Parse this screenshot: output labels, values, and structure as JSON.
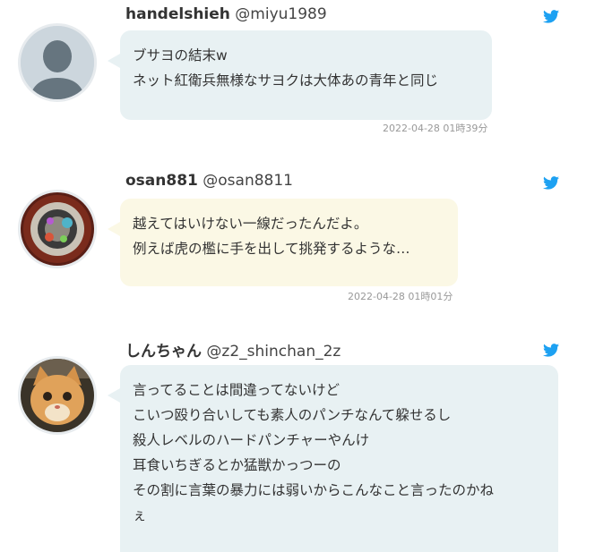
{
  "comments": [
    {
      "name": "handelshieh",
      "handle": "@miyu1989",
      "lines": [
        "ブサヨの結末w",
        "ネット紅衛兵無様なサヨクは大体あの青年と同じ"
      ],
      "timestamp": "2022-04-28 01時39分",
      "avatar_icon": "default-user-icon",
      "bubble_color": "#e8f1f3"
    },
    {
      "name": "osan881",
      "handle": "@osan8811",
      "lines": [
        "越えてはいけない一線だったんだよ。",
        "例えば虎の檻に手を出して挑発するような…"
      ],
      "timestamp": "2022-04-28 01時01分",
      "avatar_icon": "medallion-avatar-icon",
      "bubble_color": "#fbf8e5"
    },
    {
      "name": "しんちゃん",
      "handle": "@z2_shinchan_2z",
      "lines": [
        "言ってることは間違ってないけど",
        "こいつ殴り合いしても素人のパンチなんて躱せるし",
        "殺人レベルのハードパンチャーやんけ",
        "耳食いちぎるとか猛獣かっつーの",
        "その割に言葉の暴力には弱いからこんなこと言ったのかね",
        "ぇ"
      ],
      "timestamp": "",
      "avatar_icon": "cat-avatar-icon",
      "bubble_color": "#e8f1f3"
    }
  ],
  "twitter_color": "#1da1f2"
}
